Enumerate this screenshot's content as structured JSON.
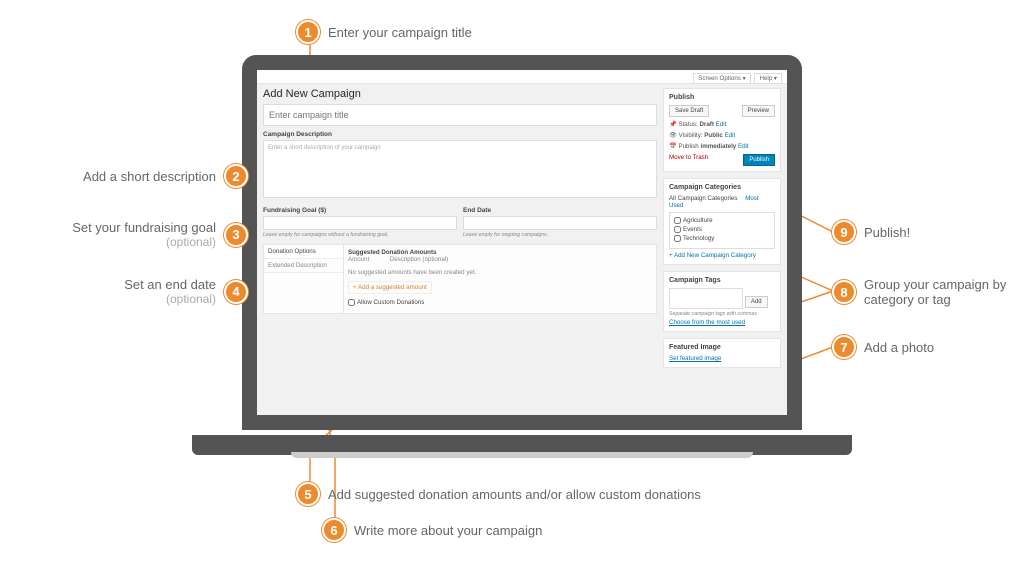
{
  "topbar": {
    "screen_options": "Screen Options ▾",
    "help": "Help ▾"
  },
  "page_title": "Add New Campaign",
  "title_placeholder": "Enter campaign title",
  "desc": {
    "label": "Campaign Description",
    "placeholder": "Enter a short description of your campaign"
  },
  "goal": {
    "label": "Fundraising Goal ($)",
    "hint": "Leave empty for campaigns without a fundraising goal."
  },
  "end_date": {
    "label": "End Date",
    "hint": "Leave empty for ongoing campaigns."
  },
  "tabs": {
    "donation": "Donation Options",
    "extended": "Extended Description"
  },
  "donation": {
    "heading": "Suggested Donation Amounts",
    "col_amount": "Amount",
    "col_desc": "Description (optional)",
    "empty": "No suggested amounts have been created yet.",
    "add_btn": "Add a suggested amount",
    "allow_custom": "Allow Custom Donations"
  },
  "publish": {
    "heading": "Publish",
    "save_draft": "Save Draft",
    "preview": "Preview",
    "status_label": "Status:",
    "status_value": "Draft",
    "visibility_label": "Visibility:",
    "visibility_value": "Public",
    "immediate_label": "Publish",
    "immediate_value": "immediately",
    "edit": "Edit",
    "trash": "Move to Trash",
    "publish_btn": "Publish"
  },
  "categories": {
    "heading": "Campaign Categories",
    "tab_all": "All Campaign Categories",
    "tab_used": "Most Used",
    "items": [
      "Agriculture",
      "Events",
      "Technology"
    ],
    "add_new": "+ Add New Campaign Category"
  },
  "tags": {
    "heading": "Campaign Tags",
    "add_btn": "Add",
    "hint": "Separate campaign tags with commas",
    "choose": "Choose from the most used"
  },
  "featured": {
    "heading": "Featured Image",
    "link": "Set featured image"
  },
  "callouts": {
    "1": "Enter your campaign title",
    "2": "Add a short description",
    "3": "Set your fundraising goal",
    "3b": "(optional)",
    "4": "Set an end date",
    "4b": "(optional)",
    "5": "Add suggested donation amounts and/or allow custom donations",
    "6": "Write more about your campaign",
    "7": "Add a photo",
    "8": "Group your campaign by category or tag",
    "9": "Publish!"
  }
}
